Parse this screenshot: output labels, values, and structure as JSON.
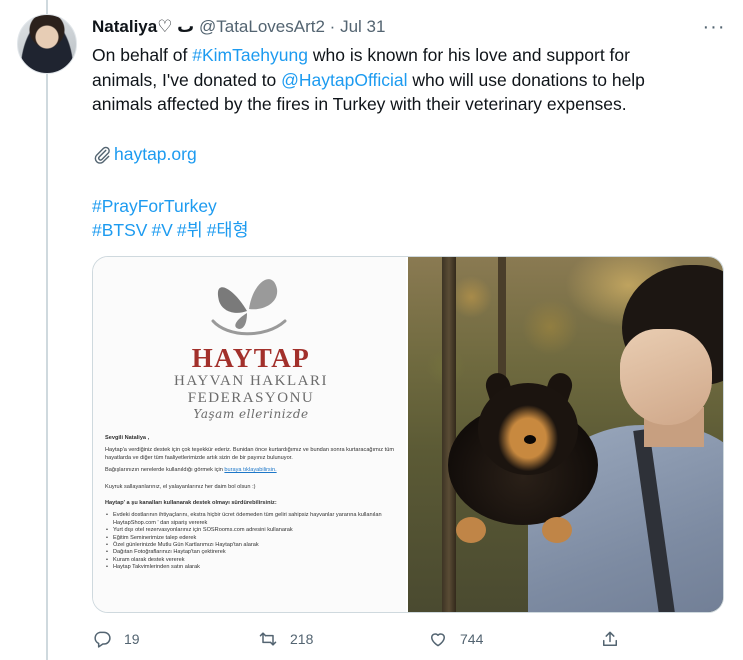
{
  "tweet": {
    "author": {
      "display_name": "Nataliya♡ ٮ",
      "handle": "@TataLovesArt2",
      "separator": "·",
      "date": "Jul 31"
    },
    "text": {
      "line1_pre": "On behalf of ",
      "line1_mention": "#KimTaehyung",
      "line1_post": " who is known for his love and support for",
      "line2_pre": "animals, I've donated to ",
      "line2_mention": "@HaytapOfficial",
      "line2_post": " who will use donations to help",
      "line3": "animals affected by the fires in Turkey with their veterinary expenses."
    },
    "link": "haytap.org",
    "hashtag_line1": "#PrayForTurkey",
    "hashtags_line2": [
      "#BTSV",
      "#V",
      "#뷔",
      "#태형"
    ],
    "media": {
      "logo": {
        "title": "HAYTAP",
        "subtitle1": "HAYVAN HAKLARI",
        "subtitle2": "FEDERASYONU",
        "script": "Yaşam ellerinizde"
      },
      "letter": {
        "greeting": "Sevgili Nataliya ,",
        "para1": "Haytap'a verdiğiniz destek için çok teşekkür ederiz. Bunidan önce kurtardığımız ve bundan sonra kurtaracağımız tüm hayatlarda ve diğer tüm faaliyetlerimizde artık sizin de bir payınız bulunuyor.",
        "para2_pre": "Bağışlarınızın nerelerde kullanıldığı görmek için ",
        "para2_link": "buraya tıklayabilirsin.",
        "para3": "Kuyruk sallayanlarınız, el yalayanlarınız her daim bol olsun :)",
        "heading": "Haytap' a şu kanalları kullanarak destek olmayı sürdürebilirsiniz:",
        "items": [
          "Evdeki dostlarının ihtiyaçlarını, ekstra hiçbir ücret ödemeden tüm geliri sahipsiz hayvanlar yararına kullanılan HaytapShop.com ' dan sipariş vererek",
          "Yurt dışı otel rezervasyonlarınız için SOSRooms.com adresini kullanarak",
          "Eğitim Seminerimize talep ederek",
          "Özel günlerinizde Mutlu Gün Kartlarımızı Haytap'tan alarak",
          "Dağıtan Fotoğraflarınızı Haytap'tan çektirerek",
          "Kuram olarak destek vererek",
          "Haytap Takvimlerinden satın alarak"
        ]
      }
    },
    "actions": {
      "replies": "19",
      "retweets": "218",
      "likes": "744"
    }
  }
}
